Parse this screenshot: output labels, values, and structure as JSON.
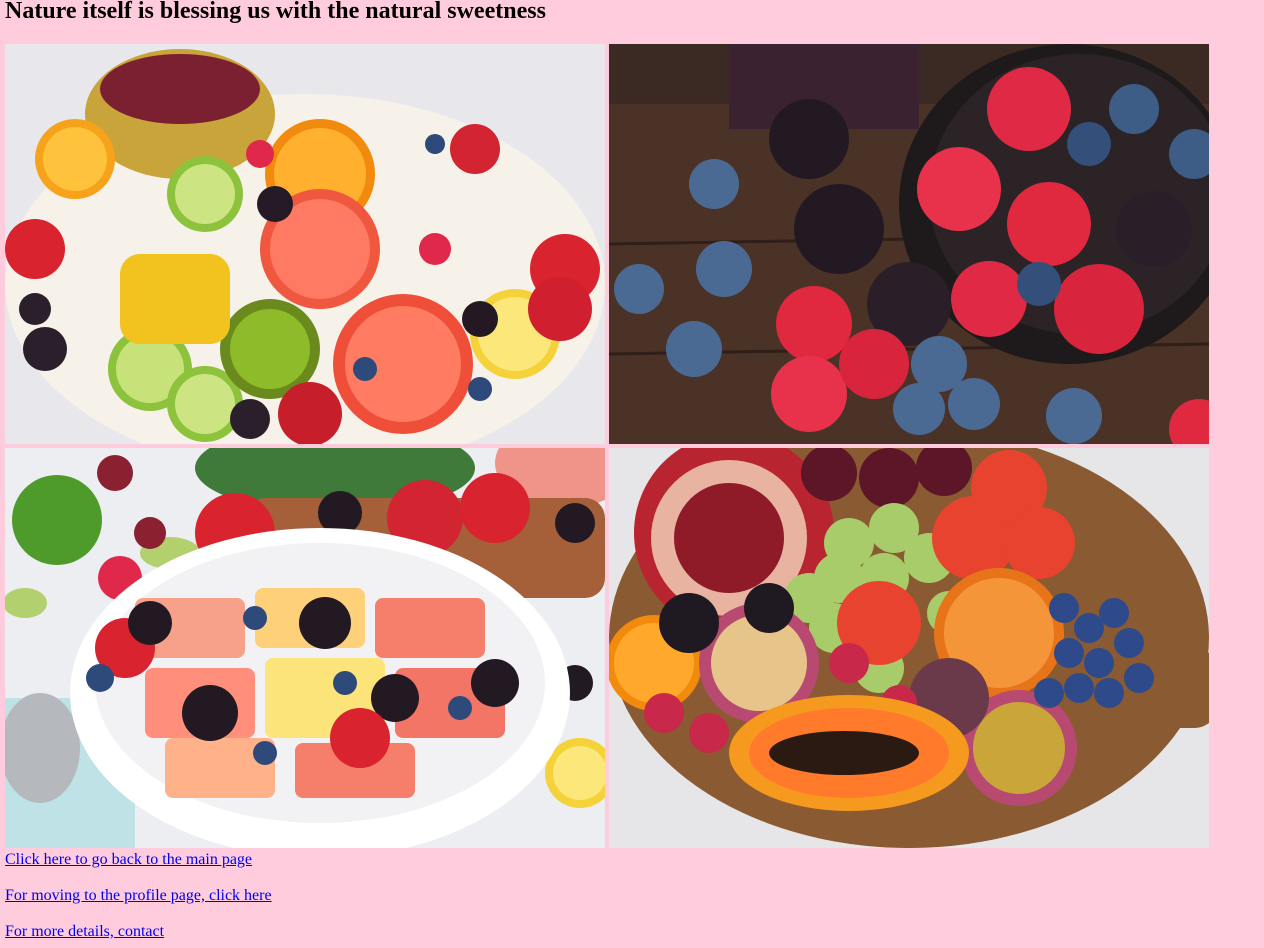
{
  "page": {
    "heading": "Nature itself is blessing us with the natural sweetness",
    "background_color": "#ffccdd",
    "link_color": "#0000ee"
  },
  "images": [
    {
      "name": "fruit-platter-image",
      "depicts": "fruit platter with pineapple, citrus slices, kiwi, mango and berries"
    },
    {
      "name": "berries-bowl-image",
      "depicts": "raspberries, blueberries and blackberries in a dark bowl on wood"
    },
    {
      "name": "fruit-salad-bowl-image",
      "depicts": "bowl of fruit salad with watermelon, strawberries and blackberries"
    },
    {
      "name": "fruit-board-image",
      "depicts": "pomegranate, grapes, papaya, orange and blueberries on a wooden board"
    }
  ],
  "links": {
    "main_page": "Click here to go back to the main page",
    "profile_page": "For moving to the profile page, click here",
    "contact": "For more details, contact"
  }
}
